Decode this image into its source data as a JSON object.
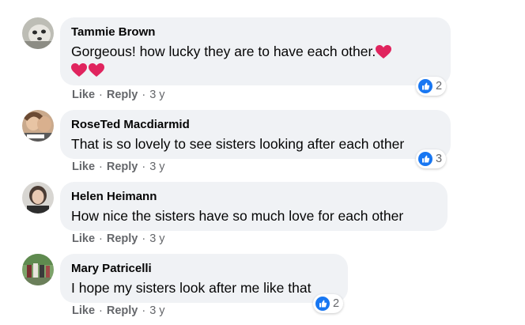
{
  "comments": [
    {
      "author": "Tammie Brown",
      "text": "Gorgeous! how lucky they are to have each other.",
      "like_label": "Like",
      "reply_label": "Reply",
      "time": "3 y",
      "reaction_count": "2",
      "reaction_icon": "like-icon"
    },
    {
      "author": "RoseTed Macdiarmid",
      "text": "That is so lovely to see sisters looking after each other",
      "like_label": "Like",
      "reply_label": "Reply",
      "time": "3 y",
      "reaction_count": "3",
      "reaction_icon": "like-icon"
    },
    {
      "author": "Helen Heimann",
      "text": "How nice the sisters have so much love for each other",
      "like_label": "Like",
      "reply_label": "Reply",
      "time": "3 y"
    },
    {
      "author": "Mary Patricelli",
      "text": "I hope my sisters look after me like that",
      "like_label": "Like",
      "reply_label": "Reply",
      "time": "3 y",
      "reaction_count": "2",
      "reaction_icon": "like-icon"
    }
  ],
  "colors": {
    "bubble": "#f0f2f5",
    "like_blue": "#1877f2",
    "heart_red": "#e0245e",
    "meta_grey": "#65676b"
  },
  "separator": "·"
}
